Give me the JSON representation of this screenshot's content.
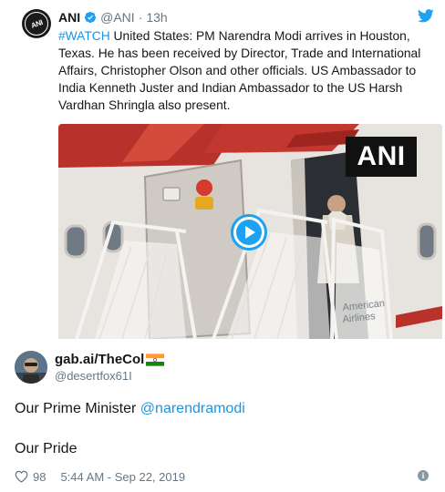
{
  "quoted_tweet": {
    "author_name": "ANI",
    "author_handle": "@ANI",
    "separator": "·",
    "timestamp": "13h",
    "hashtag": "#WATCH",
    "text": " United States: PM Narendra Modi arrives in Houston, Texas. He has been received by Director, Trade and International Affairs, Christopher Olson and other officials. US Ambassador to India Kenneth Juster and  Indian Ambassador to the US Harsh Vardhan Shringla also present.",
    "avatar_text": "ANI",
    "video_watermark": "ANI",
    "aircraft_text_1": "American",
    "aircraft_text_2": "Airlines"
  },
  "reply": {
    "author_name": "gab.ai/TheCol",
    "author_handle": "@desertfox61I",
    "text_prefix": "Our Prime Minister ",
    "mention": "@narendramodi",
    "text_line2": "Our Pride",
    "like_count": "98",
    "timestamp": "5:44 AM - Sep 22, 2019"
  },
  "colors": {
    "link": "#1b95e0",
    "twitter_blue": "#1da1f2",
    "secondary_text": "#657786"
  },
  "icons": [
    "verified-badge-icon",
    "twitter-bird-icon",
    "play-icon",
    "india-flag-icon",
    "heart-icon",
    "info-icon"
  ]
}
